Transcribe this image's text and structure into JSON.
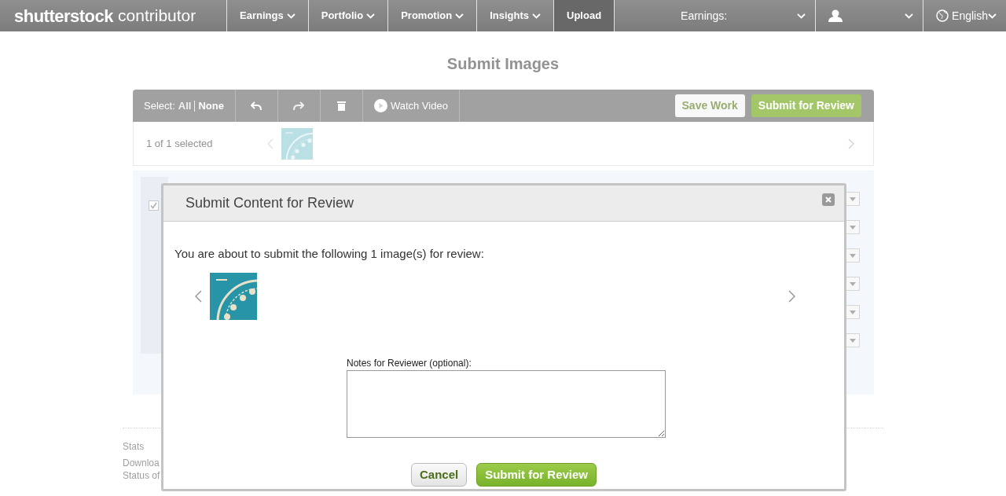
{
  "navbar": {
    "logo": "shutterstock",
    "logo_suffix": "contributor",
    "items": [
      {
        "label": "Earnings",
        "dropdown": true,
        "selected": false
      },
      {
        "label": "Portfolio",
        "dropdown": true,
        "selected": false
      },
      {
        "label": "Promotion",
        "dropdown": true,
        "selected": false
      },
      {
        "label": "Insights",
        "dropdown": true,
        "selected": false
      },
      {
        "label": "Upload",
        "dropdown": false,
        "selected": true
      }
    ],
    "earnings_label": "Earnings:",
    "language": "English"
  },
  "page_title": "Submit Images",
  "toolbar": {
    "select_label": "Select:",
    "select_all": "All",
    "select_none": "None",
    "watch_video": "Watch Video",
    "save_work": "Save Work",
    "submit": "Submit for Review"
  },
  "selection": {
    "status": "1 of 1 selected"
  },
  "item": {
    "checked": true
  },
  "footer": {
    "heading": "Stats",
    "links": [
      "Downloa",
      "Status of"
    ]
  },
  "modal": {
    "title": "Submit Content for Review",
    "message": "You are about to submit the following 1 image(s) for review:",
    "notes_label": "Notes for Reviewer (optional):",
    "cancel": "Cancel",
    "submit": "Submit for Review"
  }
}
